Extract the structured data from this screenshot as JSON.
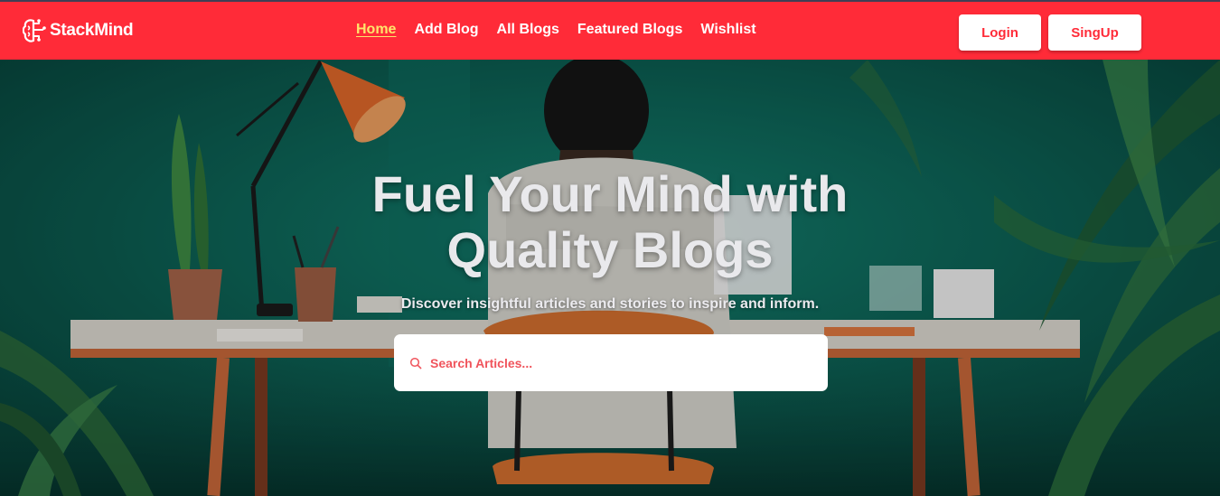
{
  "brand": {
    "name": "StackMind",
    "icon": "brain-icon"
  },
  "nav": {
    "items": [
      {
        "label": "Home",
        "active": true
      },
      {
        "label": "Add Blog",
        "active": false
      },
      {
        "label": "All Blogs",
        "active": false
      },
      {
        "label": "Featured Blogs",
        "active": false
      },
      {
        "label": "Wishlist",
        "active": false
      }
    ]
  },
  "auth": {
    "login_label": "Login",
    "signup_label": "SingUp"
  },
  "hero": {
    "title_line1": "Fuel Your Mind with",
    "title_line2": "Quality Blogs",
    "subtitle": "Discover insightful articles and stories to inspire and inform.",
    "search_placeholder": "Search Articles..."
  },
  "colors": {
    "brand_red": "#ff2b38",
    "active_link": "#ffe46b",
    "hero_wall": "#0f6b5c"
  }
}
